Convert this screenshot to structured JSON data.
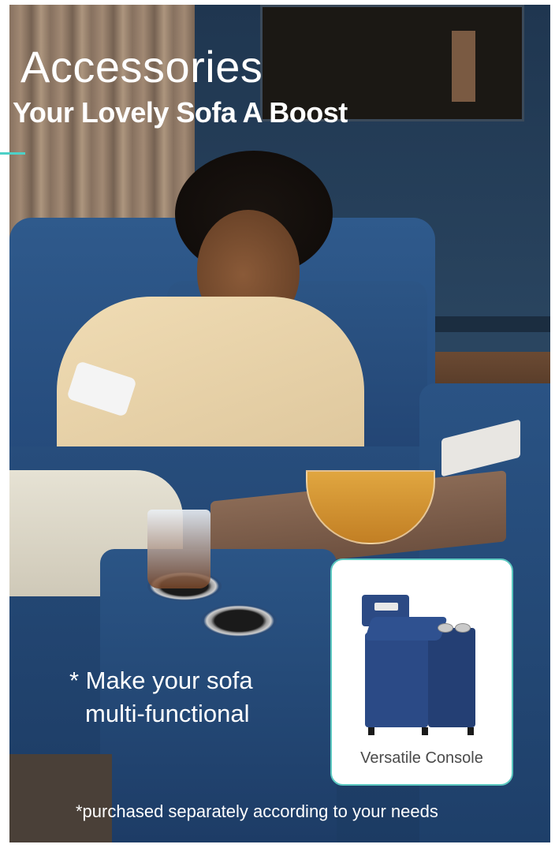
{
  "hero": {
    "title": "Accessories",
    "subtitle": "Your Lovely Sofa A Boost",
    "accent_color": "#4dd0c7"
  },
  "callout": {
    "line1": "* Make your sofa",
    "line2": "multi-functional"
  },
  "card": {
    "caption": "Versatile Console",
    "border_color": "#5cc8c0"
  },
  "footnote": "*purchased separately according to your needs"
}
